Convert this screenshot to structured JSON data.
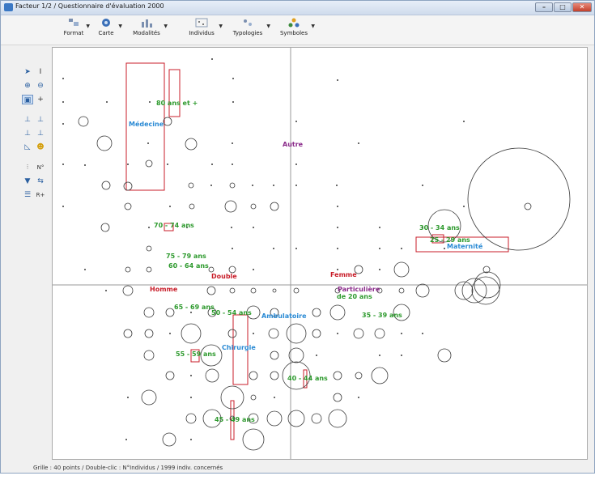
{
  "window": {
    "title": "Facteur 1/2 / Questionnaire d'évaluation 2000"
  },
  "toolbar": {
    "items": [
      {
        "label": "Format",
        "icon": "format-icon"
      },
      {
        "label": "Carte",
        "icon": "map-icon"
      },
      {
        "label": "Modalités",
        "icon": "modalities-icon"
      },
      {
        "label": "Individus",
        "icon": "individuals-icon"
      },
      {
        "label": "Typologies",
        "icon": "typologies-icon"
      },
      {
        "label": "Symboles",
        "icon": "symbols-icon"
      }
    ]
  },
  "left_tools": {
    "n_label": "N°",
    "r_label": "R+"
  },
  "colors": {
    "green": "#2e9a2e",
    "blue": "#2a8ad4",
    "purple": "#8a2a8a",
    "red": "#c81e2a",
    "grid": "#9a9a9a",
    "point": "#3a3a3a"
  },
  "labels": [
    {
      "text": "80 ans et +",
      "color": "green"
    },
    {
      "text": "Médecine",
      "color": "blue"
    },
    {
      "text": "Autre",
      "color": "purple"
    },
    {
      "text": "70 - 74 ans",
      "color": "green"
    },
    {
      "text": "30 - 34 ans",
      "color": "green"
    },
    {
      "text": "25 - 29 ans",
      "color": "green"
    },
    {
      "text": "Maternité",
      "color": "blue"
    },
    {
      "text": "75 - 79 ans",
      "color": "green"
    },
    {
      "text": "60 - 64 ans",
      "color": "green"
    },
    {
      "text": "Double",
      "color": "red"
    },
    {
      "text": "Femme",
      "color": "red"
    },
    {
      "text": "Homme",
      "color": "red"
    },
    {
      "text": "Particulière",
      "color": "purple"
    },
    {
      "text": "de 20 ans",
      "color": "green"
    },
    {
      "text": "65 - 69 ans",
      "color": "green"
    },
    {
      "text": "50 - 54 ans",
      "color": "green"
    },
    {
      "text": "Ambulatoire",
      "color": "blue"
    },
    {
      "text": "35 - 39 ans",
      "color": "green"
    },
    {
      "text": "Chirurgie",
      "color": "blue"
    },
    {
      "text": "55 - 59 ans",
      "color": "green"
    },
    {
      "text": "40 - 44 ans",
      "color": "green"
    },
    {
      "text": "45 - 49 ans",
      "color": "green"
    }
  ],
  "status": {
    "text": "Grille : 40 points / Double-clic : N°Individus / 1999 indiv. concernés"
  }
}
